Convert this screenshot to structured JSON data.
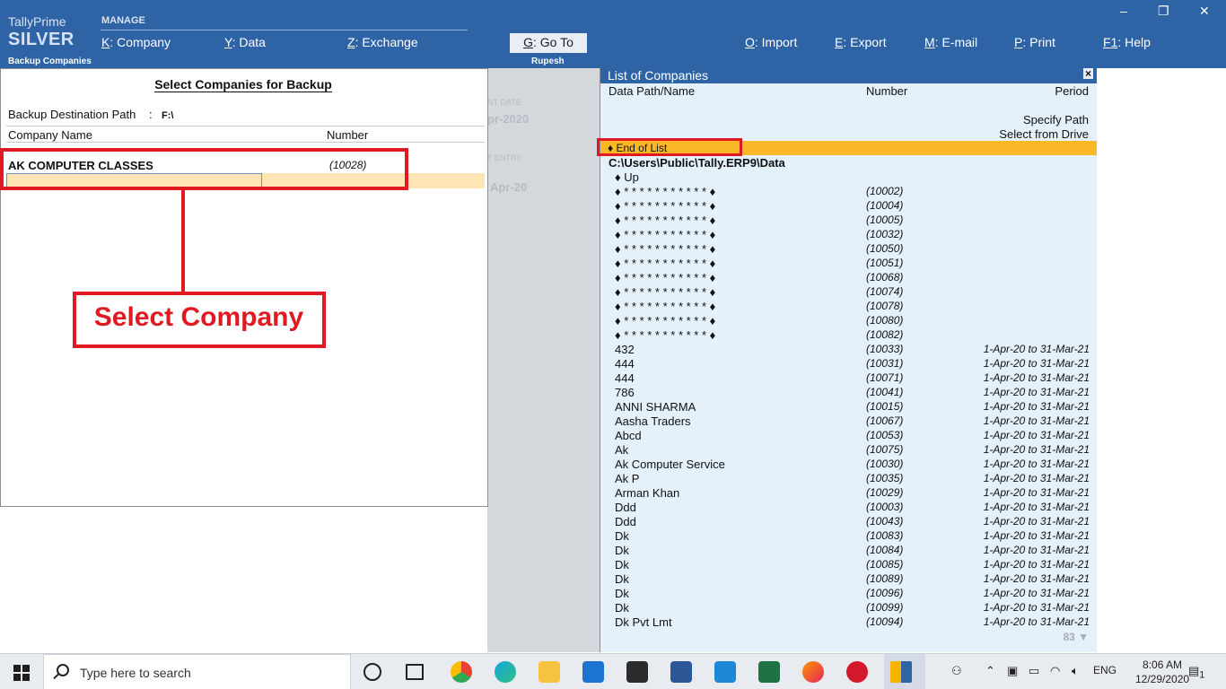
{
  "topbar": {
    "brand_line1": "TallyPrime",
    "brand_line2": "SILVER",
    "section": "MANAGE",
    "menu": [
      {
        "key": "K",
        "label": "Company"
      },
      {
        "key": "Y",
        "label": "Data"
      },
      {
        "key": "Z",
        "label": "Exchange"
      }
    ],
    "goto": {
      "key": "G",
      "label": "Go To"
    },
    "actions": [
      {
        "key": "O",
        "label": "Import"
      },
      {
        "key": "E",
        "label": "Export"
      },
      {
        "key": "M",
        "label": "E-mail"
      },
      {
        "key": "P",
        "label": "Print"
      },
      {
        "key": "F1",
        "label": "Help"
      }
    ],
    "window_controls": {
      "minimize": "‒",
      "restore": "❐",
      "close": "✕"
    }
  },
  "subbar": {
    "left": "Backup Companies",
    "center": "Rupesh"
  },
  "background_ghost": {
    "label1": "NT DATE",
    "value1": "pr-2020",
    "label2": "T ENTRY",
    "value2": "Apr-20"
  },
  "backup": {
    "title": "Select Companies for Backup",
    "dest_label": "Backup Destination Path",
    "dest_colon": ":",
    "dest_value": "F:\\",
    "col_name": "Company Name",
    "col_number": "Number",
    "company": {
      "name": "AK COMPUTER CLASSES",
      "number": "(10028)"
    }
  },
  "annotation": {
    "text": "Select Company",
    "color": "#e01a22"
  },
  "list": {
    "title": "List of Companies",
    "close": "×",
    "header": {
      "path": "Data Path/Name",
      "number": "Number",
      "period": "Period"
    },
    "specify_path": "Specify Path",
    "select_drive": "Select from Drive",
    "end_of_list": "End of List",
    "bullet": "♦",
    "data_path": "C:\\Users\\Public\\Tally.ERP9\\Data",
    "up": "Up",
    "more_count": "83 ▼",
    "rows": [
      {
        "name": "♦ * * * * * * * * * * * ♦",
        "number": "(10002)",
        "period": ""
      },
      {
        "name": "♦ * * * * * * * * * * * ♦",
        "number": "(10004)",
        "period": ""
      },
      {
        "name": "♦ * * * * * * * * * * * ♦",
        "number": "(10005)",
        "period": ""
      },
      {
        "name": "♦ * * * * * * * * * * * ♦",
        "number": "(10032)",
        "period": ""
      },
      {
        "name": "♦ * * * * * * * * * * * ♦",
        "number": "(10050)",
        "period": ""
      },
      {
        "name": "♦ * * * * * * * * * * * ♦",
        "number": "(10051)",
        "period": ""
      },
      {
        "name": "♦ * * * * * * * * * * * ♦",
        "number": "(10068)",
        "period": ""
      },
      {
        "name": "♦ * * * * * * * * * * * ♦",
        "number": "(10074)",
        "period": ""
      },
      {
        "name": "♦ * * * * * * * * * * * ♦",
        "number": "(10078)",
        "period": ""
      },
      {
        "name": "♦ * * * * * * * * * * * ♦",
        "number": "(10080)",
        "period": ""
      },
      {
        "name": "♦ * * * * * * * * * * * ♦",
        "number": "(10082)",
        "period": ""
      },
      {
        "name": "432",
        "number": "(10033)",
        "period": "1-Apr-20 to 31-Mar-21"
      },
      {
        "name": "444",
        "number": "(10031)",
        "period": "1-Apr-20 to 31-Mar-21"
      },
      {
        "name": "444",
        "number": "(10071)",
        "period": "1-Apr-20 to 31-Mar-21"
      },
      {
        "name": "786",
        "number": "(10041)",
        "period": "1-Apr-20 to 31-Mar-21"
      },
      {
        "name": "ANNI SHARMA",
        "number": "(10015)",
        "period": "1-Apr-20 to 31-Mar-21"
      },
      {
        "name": "Aasha Traders",
        "number": "(10067)",
        "period": "1-Apr-20 to 31-Mar-21"
      },
      {
        "name": "Abcd",
        "number": "(10053)",
        "period": "1-Apr-20 to 31-Mar-21"
      },
      {
        "name": "Ak",
        "number": "(10075)",
        "period": "1-Apr-20 to 31-Mar-21"
      },
      {
        "name": "Ak Computer Service",
        "number": "(10030)",
        "period": "1-Apr-20 to 31-Mar-21"
      },
      {
        "name": "Ak P",
        "number": "(10035)",
        "period": "1-Apr-20 to 31-Mar-21"
      },
      {
        "name": "Arman Khan",
        "number": "(10029)",
        "period": "1-Apr-20 to 31-Mar-21"
      },
      {
        "name": "Ddd",
        "number": "(10003)",
        "period": "1-Apr-20 to 31-Mar-21"
      },
      {
        "name": "Ddd",
        "number": "(10043)",
        "period": "1-Apr-20 to 31-Mar-21"
      },
      {
        "name": "Dk",
        "number": "(10083)",
        "period": "1-Apr-20 to 31-Mar-21"
      },
      {
        "name": "Dk",
        "number": "(10084)",
        "period": "1-Apr-20 to 31-Mar-21"
      },
      {
        "name": "Dk",
        "number": "(10085)",
        "period": "1-Apr-20 to 31-Mar-21"
      },
      {
        "name": "Dk",
        "number": "(10089)",
        "period": "1-Apr-20 to 31-Mar-21"
      },
      {
        "name": "Dk",
        "number": "(10096)",
        "period": "1-Apr-20 to 31-Mar-21"
      },
      {
        "name": "Dk",
        "number": "(10099)",
        "period": "1-Apr-20 to 31-Mar-21"
      },
      {
        "name": "Dk Pvt Lmt",
        "number": "(10094)",
        "period": "1-Apr-20 to 31-Mar-21"
      }
    ]
  },
  "taskbar": {
    "search_placeholder": "Type here to search",
    "language": "ENG",
    "time": "8:06 AM",
    "date": "12/29/2020",
    "notification_count": "1",
    "apps": [
      "task-view-icon",
      "chrome-icon",
      "edge-icon",
      "file-explorer-icon",
      "mail-icon",
      "store-icon",
      "word-icon",
      "vscode-icon",
      "excel-icon",
      "firefox-icon",
      "opera-icon",
      "tally-icon"
    ]
  },
  "colors": {
    "brand_blue": "#2e63a5",
    "highlight": "#fbb826",
    "list_bg": "#e4f0fa",
    "annotation_red": "#e01a22"
  }
}
